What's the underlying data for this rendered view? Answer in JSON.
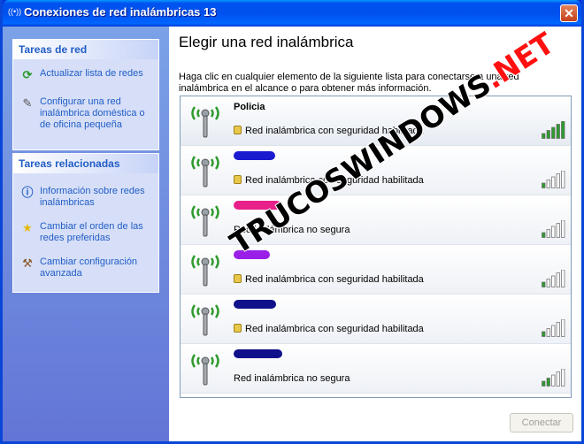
{
  "window": {
    "title": "Conexiones de red inalámbricas 13",
    "close_label": "✕"
  },
  "sidebar": {
    "panels": [
      {
        "header": "Tareas de red",
        "items": [
          {
            "label": "Actualizar lista de redes",
            "icon": "refresh-icon"
          },
          {
            "label": "Configurar una red inalámbrica doméstica o de oficina pequeña",
            "icon": "wireless-setup-icon"
          }
        ]
      },
      {
        "header": "Tareas relacionadas",
        "items": [
          {
            "label": "Información sobre redes inalámbricas",
            "icon": "info-icon"
          },
          {
            "label": "Cambiar el orden de las redes preferidas",
            "icon": "star-icon"
          },
          {
            "label": "Cambiar configuración avanzada",
            "icon": "settings-icon"
          }
        ]
      }
    ]
  },
  "main": {
    "title": "Elegir una red inalámbrica",
    "description": "Haga clic en cualquier elemento de la siguiente lista para conectarse a una red inalámbrica en el alcance o para obtener más información.",
    "connect_label": "Conectar"
  },
  "networks": [
    {
      "ssid": "Policia",
      "status": "Red inalámbrica con seguridad habilitada",
      "secured": true,
      "signal_bars": 5,
      "redacted_color": ""
    },
    {
      "ssid": "",
      "status": "Red inalámbrica con seguridad habilitada",
      "secured": true,
      "signal_bars": 1,
      "redacted_color": "#1a1ad0"
    },
    {
      "ssid": "",
      "status": "Red inalámbrica no segura",
      "secured": false,
      "signal_bars": 1,
      "redacted_color": "#e8208a"
    },
    {
      "ssid": "",
      "status": "Red inalámbrica con seguridad habilitada",
      "secured": true,
      "signal_bars": 1,
      "redacted_color": "#9a20e8"
    },
    {
      "ssid": "",
      "status": "Red inalámbrica con seguridad habilitada",
      "secured": true,
      "signal_bars": 1,
      "redacted_color": "#10108a"
    },
    {
      "ssid": "",
      "status": "Red inalámbrica no segura",
      "secured": false,
      "signal_bars": 2,
      "redacted_color": "#10108a"
    }
  ],
  "watermark": {
    "part1": "TRUCOSWINDOWS",
    "part2": ".NET"
  },
  "colors": {
    "signal_on": "#2e9a2e",
    "signal_off": "#ffffff",
    "link": "#215dc6"
  }
}
